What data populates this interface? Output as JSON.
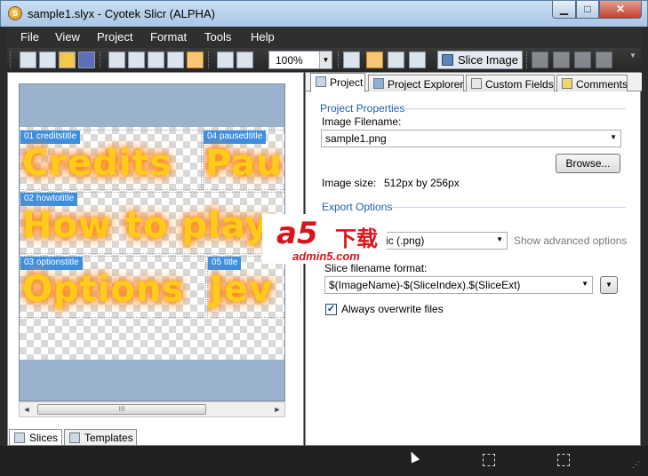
{
  "window": {
    "title": "sample1.slyx - Cyotek Slicr (ALPHA)",
    "minimize": "▁",
    "maximize": "□",
    "close": "✕",
    "app_icon": "S"
  },
  "menu": [
    "File",
    "View",
    "Project",
    "Format",
    "Tools",
    "Help"
  ],
  "toolbar": {
    "zoom": "100%",
    "slice_image_label": "Slice Image",
    "dropdown_glyph": "▼"
  },
  "canvas": {
    "slices": [
      {
        "tag": "01 creditstitle",
        "art": "Credits"
      },
      {
        "tag": "04 pausedtitle",
        "art": "Pau"
      },
      {
        "tag": "02 howtotitle",
        "art": "How to play"
      },
      {
        "tag": "03 optionstitle",
        "art": "Options"
      },
      {
        "tag": "05 title",
        "art": "Jev"
      }
    ],
    "scroll_left": "◄",
    "scroll_right": "►",
    "scroll_grip": "III"
  },
  "bottom_tabs": [
    "Slices",
    "Templates"
  ],
  "right_tabs": [
    "Project",
    "Project Explorer",
    "Custom Fields",
    "Comments"
  ],
  "project_properties": {
    "title": "Project Properties",
    "image_filename_label": "Image Filename:",
    "image_filename": "sample1.png",
    "browse": "Browse...",
    "image_size_label": "Image size:",
    "image_size_value": "512px by 256px"
  },
  "export_options": {
    "title": "Export Options",
    "format_value": "works Graphic (.png)",
    "show_advanced": "Show advanced options",
    "slice_format_label": "Slice filename format:",
    "slice_format_value": "$(ImageName)-$(SliceIndex).$(SliceExt)",
    "overwrite_label": "Always overwrite files",
    "overwrite_checked": "✓"
  },
  "watermark": {
    "brand": "a5",
    "cn": "下载",
    "url": "admin5.com"
  },
  "statusbar": {
    "grip": "⋰"
  }
}
